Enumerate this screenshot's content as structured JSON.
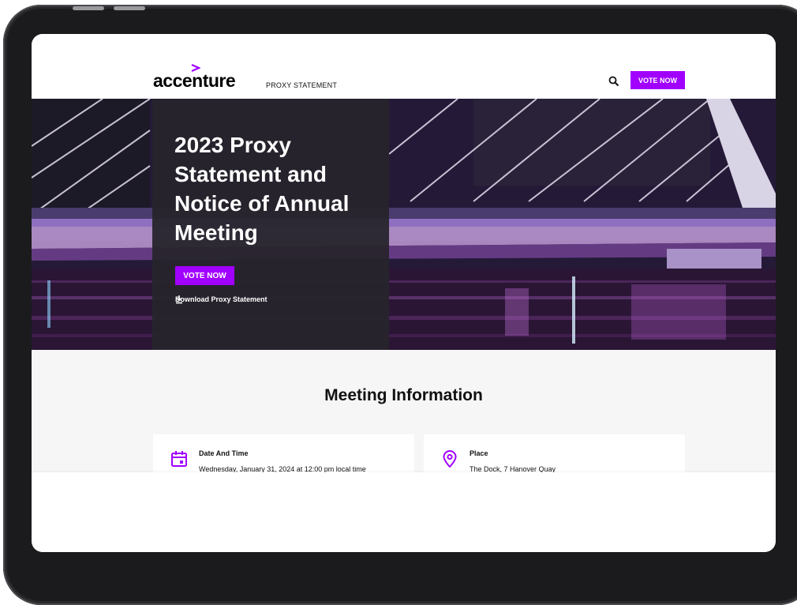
{
  "header": {
    "logo_text": "accenture",
    "nav_link": "PROXY STATEMENT",
    "vote_button": "VOTE NOW"
  },
  "hero": {
    "title": "2023 Proxy Statement and Notice of Annual Meeting",
    "vote_button": "VOTE NOW",
    "download_link": "Download Proxy Statement"
  },
  "meeting": {
    "title": "Meeting Information",
    "cards": [
      {
        "icon": "calendar-icon",
        "title": "Date And Time",
        "text": "Wednesday, January 31, 2024 at 12:00 pm local time"
      },
      {
        "icon": "location-pin-icon",
        "title": "Place",
        "text": "The Dock, 7 Hanover Quay"
      }
    ]
  },
  "colors": {
    "accent": "#a100ff",
    "hero_panel": "#26242c",
    "device_frame": "#1b1b1d"
  }
}
